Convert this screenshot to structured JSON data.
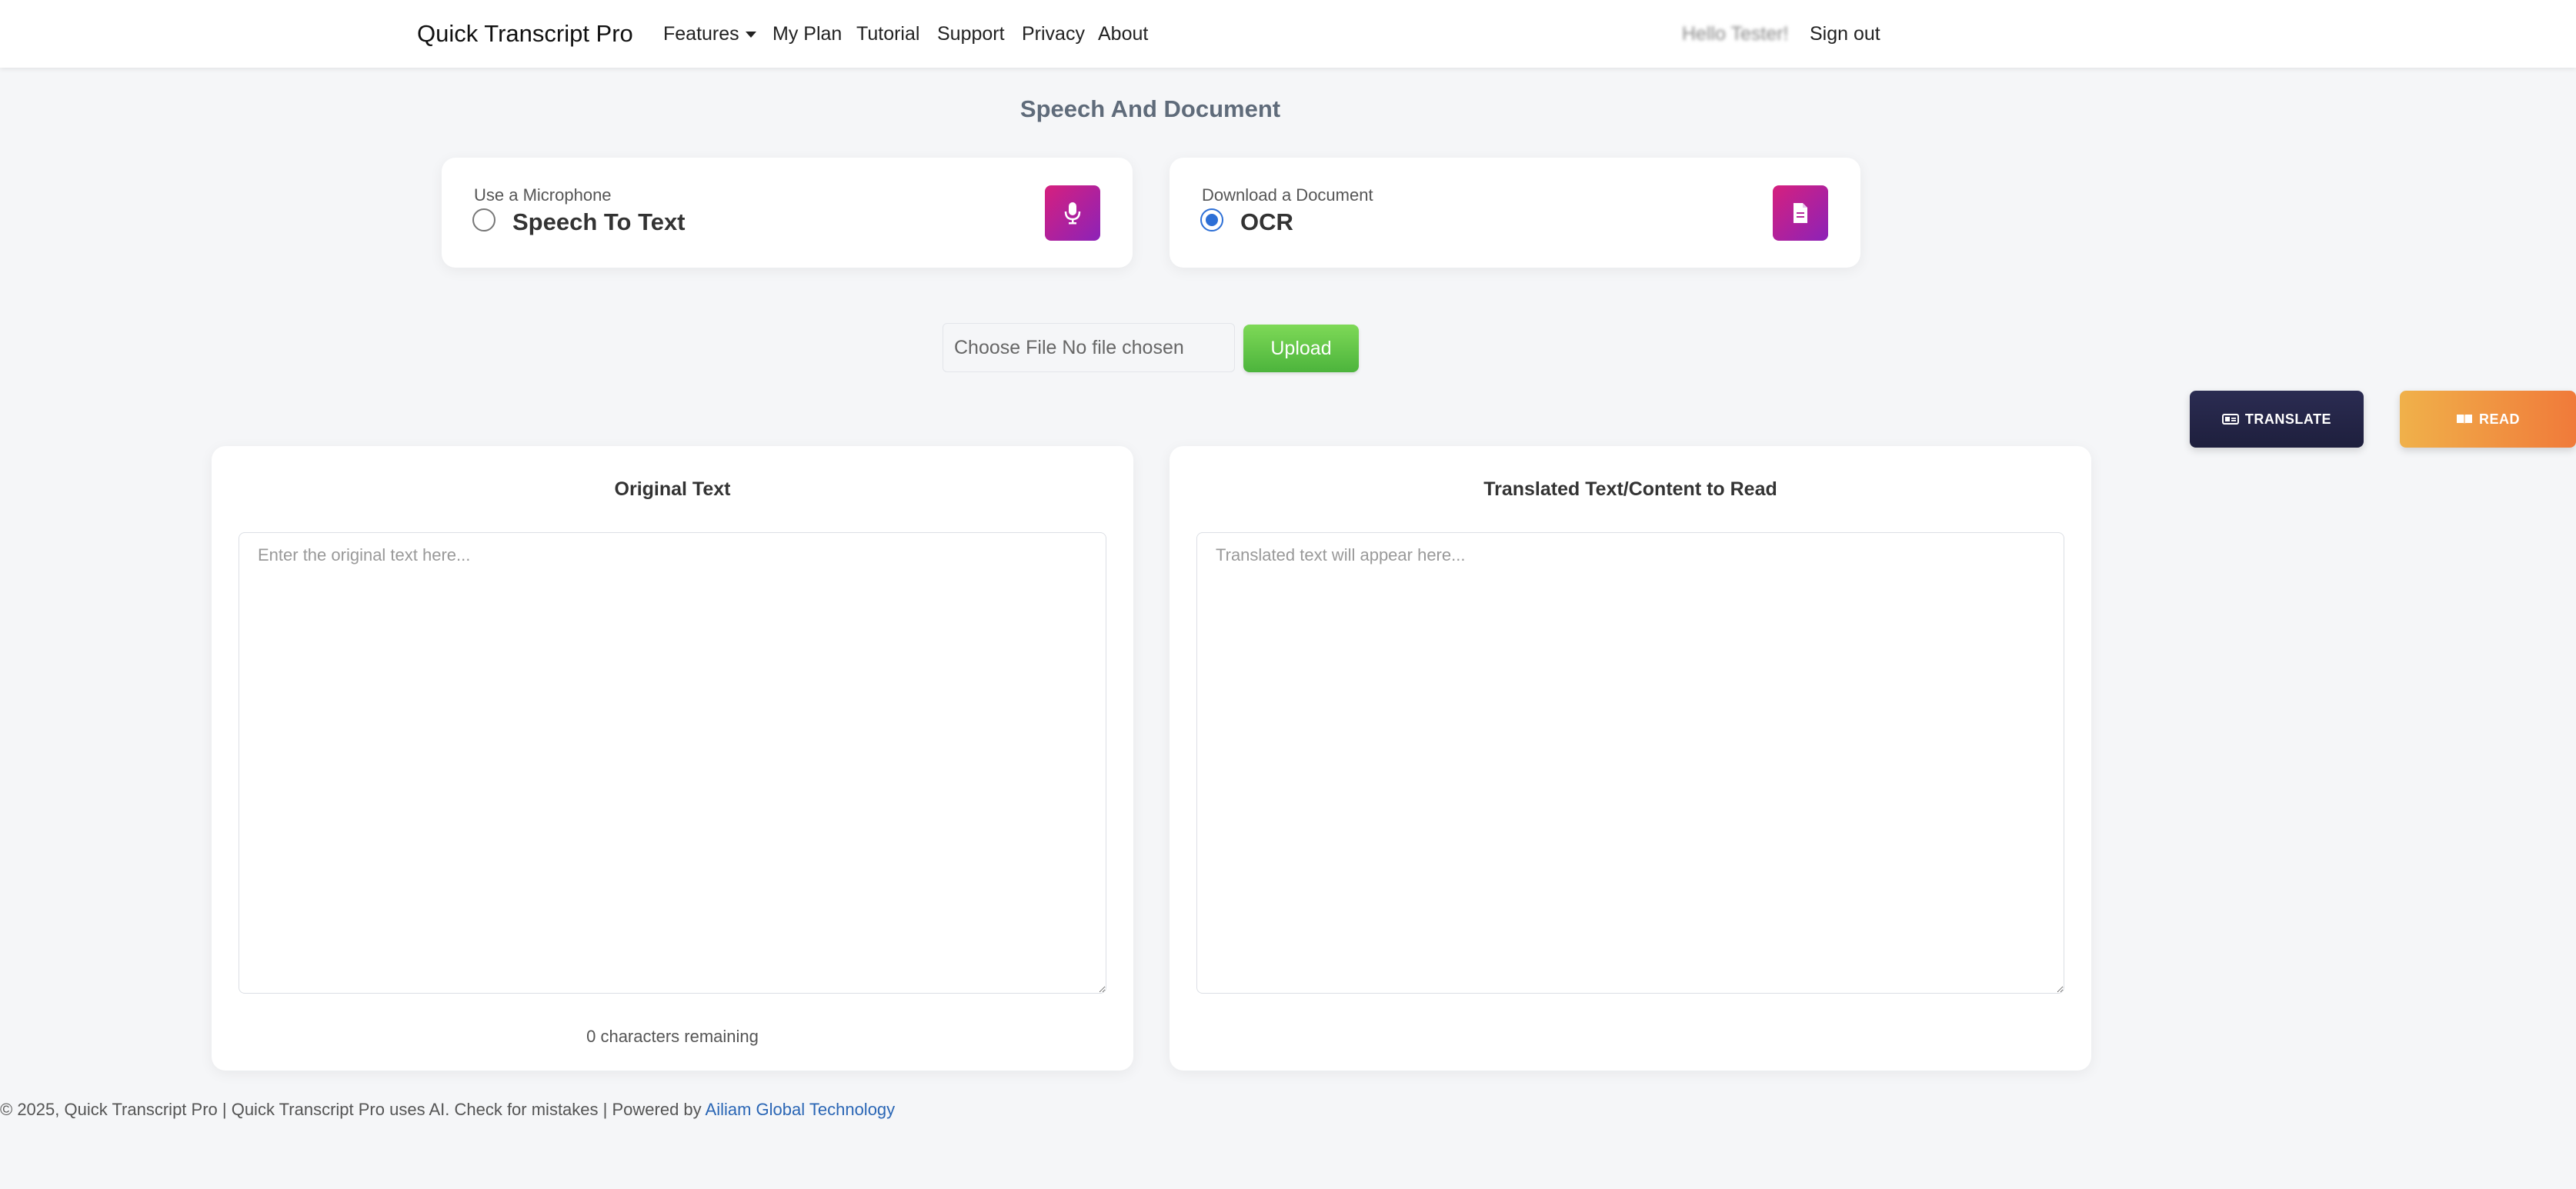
{
  "navbar": {
    "brand": "Quick Transcript Pro",
    "links": [
      "Features",
      "My Plan",
      "Tutorial",
      "Support",
      "Privacy",
      "About"
    ],
    "greeting": "Hello Tester!",
    "sign_out": "Sign out"
  },
  "section_title": "Speech And Document",
  "options": [
    {
      "subtitle": "Use a Microphone",
      "label": "Speech To Text",
      "selected": false,
      "icon": "microphone-icon"
    },
    {
      "subtitle": "Download a Document",
      "label": "OCR",
      "selected": true,
      "icon": "document-icon"
    }
  ],
  "upload": {
    "file_status": "Choose File No file chosen",
    "button": "Upload"
  },
  "actions": {
    "translate": "TRANSLATE",
    "read": "READ"
  },
  "original_panel": {
    "title": "Original Text",
    "placeholder": "Enter the original text here...",
    "chars_remaining": "0 characters remaining"
  },
  "translated_panel": {
    "title": "Translated Text/Content to Read",
    "placeholder": "Translated text will appear here..."
  },
  "footer": {
    "text": "© 2025, Quick Transcript Pro | Quick Transcript Pro uses AI. Check for mistakes | Powered by ",
    "link": "Ailiam Global Technology"
  },
  "colors": {
    "accent_gradient_start": "#d6207e",
    "accent_gradient_end": "#8c22b8",
    "upload_green": "#5cc043",
    "translate_dark": "#24254a",
    "read_orange": "#f09a42",
    "link_blue": "#2a66b5"
  }
}
